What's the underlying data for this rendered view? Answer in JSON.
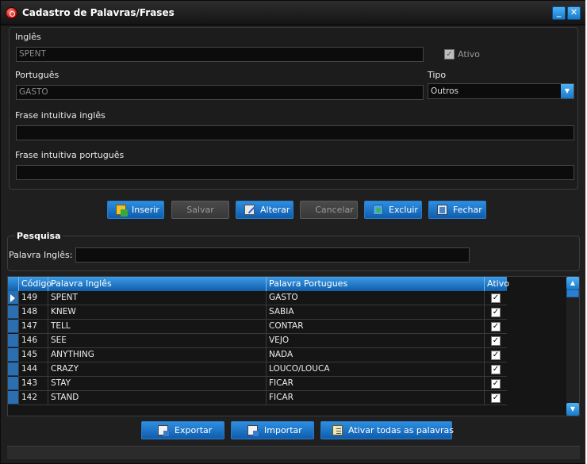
{
  "window": {
    "title": "Cadastro de Palavras/Frases"
  },
  "form": {
    "ingles_label": "Inglês",
    "ingles_value": "SPENT",
    "ativo_label": "Ativo",
    "portugues_label": "Português",
    "portugues_value": "GASTO",
    "tipo_label": "Tipo",
    "tipo_value": "Outros",
    "frase_ingles_label": "Frase intuitiva inglês",
    "frase_ingles_value": "",
    "frase_portugues_label": "Frase intuitiva português",
    "frase_portugues_value": ""
  },
  "actions": {
    "inserir": "Inserir",
    "salvar": "Salvar",
    "alterar": "Alterar",
    "cancelar": "Cancelar",
    "excluir": "Excluir",
    "fechar": "Fechar"
  },
  "search": {
    "title": "Pesquisa",
    "label": "Palavra Inglês:",
    "value": ""
  },
  "grid": {
    "columns": [
      "Código",
      "Palavra Inglês",
      "Palavra Portugues",
      "Ativo"
    ],
    "rows": [
      {
        "code": "149",
        "en": "SPENT",
        "pt": "GASTO",
        "active": true
      },
      {
        "code": "148",
        "en": "KNEW",
        "pt": "SABIA",
        "active": true
      },
      {
        "code": "147",
        "en": "TELL",
        "pt": "CONTAR",
        "active": true
      },
      {
        "code": "146",
        "en": "SEE",
        "pt": "VEJO",
        "active": true
      },
      {
        "code": "145",
        "en": "ANYTHING",
        "pt": "NADA",
        "active": true
      },
      {
        "code": "144",
        "en": "CRAZY",
        "pt": "LOUCO/LOUCA",
        "active": true
      },
      {
        "code": "143",
        "en": "STAY",
        "pt": "FICAR",
        "active": true
      },
      {
        "code": "142",
        "en": "STAND",
        "pt": "FICAR",
        "active": true
      }
    ]
  },
  "footer": {
    "exportar": "Exportar",
    "importar": "Importar",
    "ativar_todas": "Ativar todas as palavras"
  },
  "colors": {
    "accent": "#1779c9",
    "window_bg": "#1f1f1f",
    "field_bg": "#0c0c0c"
  }
}
